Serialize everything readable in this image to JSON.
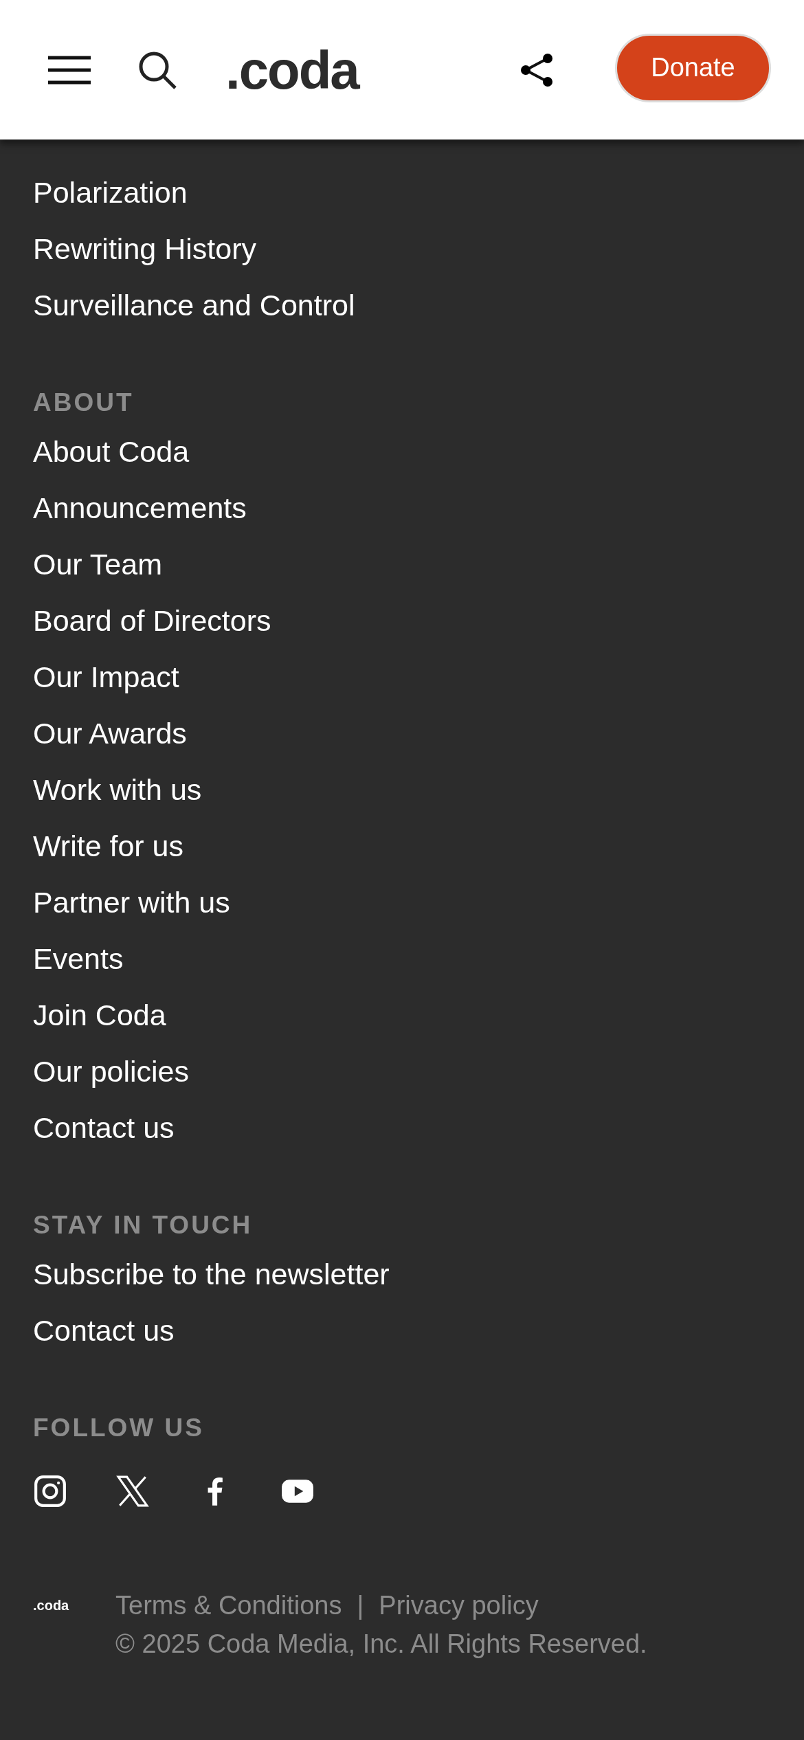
{
  "header": {
    "logo": ".coda",
    "donate": "Donate"
  },
  "top_links": [
    "Polarization",
    "Rewriting History",
    "Surveillance and Control"
  ],
  "sections": [
    {
      "heading": "ABOUT",
      "links": [
        "About Coda",
        "Announcements",
        "Our Team",
        "Board of Directors",
        "Our Impact",
        "Our Awards",
        "Work with us",
        "Write for us",
        "Partner with us",
        "Events",
        "Join Coda",
        "Our policies",
        "Contact us"
      ]
    },
    {
      "heading": "STAY IN TOUCH",
      "links": [
        "Subscribe to the newsletter",
        "Contact us"
      ]
    }
  ],
  "follow": {
    "heading": "FOLLOW US",
    "icons": [
      {
        "kind": "instagram"
      },
      {
        "kind": "x"
      },
      {
        "kind": "facebook"
      },
      {
        "kind": "youtube"
      }
    ]
  },
  "footer": {
    "logo": ".coda",
    "links": [
      "Terms & Conditions",
      "Privacy policy"
    ],
    "separator": "|",
    "copyright": "© 2025 Coda Media, Inc. All Rights Reserved."
  }
}
